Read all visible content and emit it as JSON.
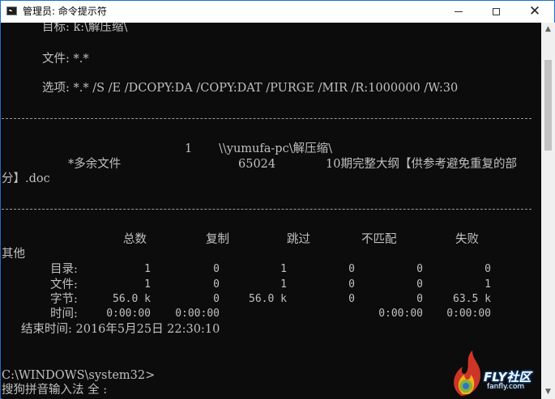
{
  "window": {
    "title": "管理员: 命令提示符"
  },
  "header": {
    "target": "目标: k:\\解压缩\\",
    "files": "文件: *.*",
    "options": "选项: *.* /S /E /DCOPY:DA /COPY:DAT /PURGE /MIR /R:1000000 /W:30"
  },
  "listing": {
    "count": "1",
    "path": "\\\\yumufa-pc\\解压缩\\",
    "status": "*多余文件",
    "size": "65024",
    "name_part1": "10期完整大纲【供参考避免重复的部",
    "name_part2": "分】.doc"
  },
  "summary": {
    "columns": [
      "总数",
      "复制",
      "跳过",
      "不匹配",
      "失败",
      "其他"
    ],
    "rows": [
      {
        "label": "目录:",
        "values": [
          "1",
          "0",
          "1",
          "0",
          "0",
          "0"
        ]
      },
      {
        "label": "文件:",
        "values": [
          "1",
          "0",
          "1",
          "0",
          "0",
          "1"
        ]
      },
      {
        "label": "字节:",
        "values": [
          "56.0 k",
          "0",
          "56.0 k",
          "0",
          "0",
          "63.5 k"
        ]
      },
      {
        "label": "时间:",
        "values": [
          "0:00:00",
          "0:00:00",
          "",
          "",
          "0:00:00",
          "0:00:00"
        ]
      }
    ],
    "end_time": "结束时间: 2016年5月25日 22:30:10"
  },
  "prompt": {
    "path": "C:\\WINDOWS\\system32>",
    "ime": "搜狗拼音输入法 全 :"
  },
  "watermark": {
    "brand": "FLY社区",
    "site": "fanfly.com"
  },
  "colors": {
    "console_bg": "#0c0c0c",
    "console_text": "#c0c0c0",
    "window_border": "#1a72c9"
  }
}
